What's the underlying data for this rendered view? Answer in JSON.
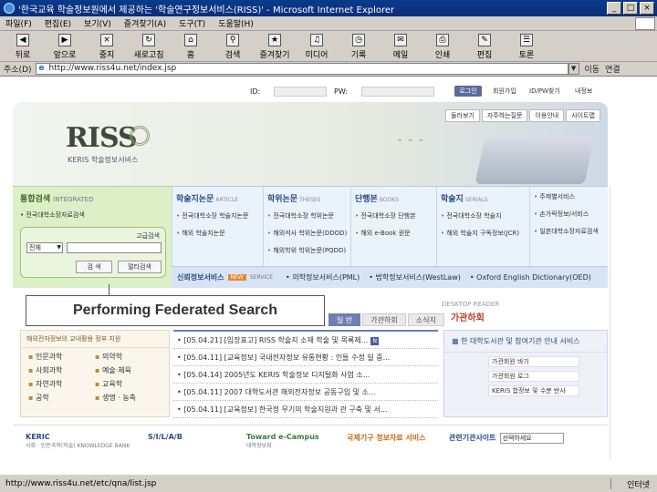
{
  "window": {
    "title": "'한국교육 학술정보원에서 제공하는 '학술연구정보서비스(RISS)' - Microsoft Internet Explorer",
    "buttons": [
      "_",
      "□",
      "×"
    ]
  },
  "menu": [
    "파일(F)",
    "편집(E)",
    "보기(V)",
    "즐겨찾기(A)",
    "도구(T)",
    "도움말(H)"
  ],
  "toolbar": [
    {
      "label": "뒤로",
      "icon": "back-arrow-icon",
      "glyph": "◀"
    },
    {
      "label": "앞으로",
      "icon": "forward-arrow-icon",
      "glyph": "▶"
    },
    {
      "label": "중지",
      "icon": "stop-icon",
      "glyph": "×"
    },
    {
      "label": "새로고침",
      "icon": "refresh-icon",
      "glyph": "↻"
    },
    {
      "label": "홈",
      "icon": "home-icon",
      "glyph": "⌂"
    },
    {
      "label": "검색",
      "icon": "search-icon",
      "glyph": "⚲"
    },
    {
      "label": "즐겨찾기",
      "icon": "favorites-icon",
      "glyph": "★"
    },
    {
      "label": "미디어",
      "icon": "media-icon",
      "glyph": "♫"
    },
    {
      "label": "기록",
      "icon": "history-icon",
      "glyph": "◷"
    },
    {
      "label": "메일",
      "icon": "mail-icon",
      "glyph": "✉"
    },
    {
      "label": "인쇄",
      "icon": "print-icon",
      "glyph": "⎙"
    },
    {
      "label": "편집",
      "icon": "edit-icon",
      "glyph": "✎"
    },
    {
      "label": "토론",
      "icon": "discuss-icon",
      "glyph": "☰"
    }
  ],
  "address": {
    "label": "주소(D)",
    "url": "http://www.riss4u.net/index.jsp",
    "go": "이동",
    "links": "연결"
  },
  "login": {
    "id_label": "ID:",
    "pw_label": "PW:",
    "button": "로그인",
    "links": [
      "회원가입",
      "ID/PW찾기",
      "내정보"
    ]
  },
  "hero": {
    "logo": "RISS",
    "logo_sub": "KERIS 학술정보서비스",
    "top_links": [
      "둘러보기",
      "자주하는질문",
      "이용안내",
      "사이트맵"
    ]
  },
  "search": {
    "heading": "통합검색",
    "heading_en": "INTEGRATED",
    "option": "전국대학소장자료검색",
    "advanced": "고급검색",
    "select_value": "전체",
    "query": "",
    "search_button": "검 색",
    "multi_button": "멀티검색"
  },
  "categories": [
    {
      "title": "학술지논문",
      "en": "ARTICLE",
      "items": [
        "전국대학소장 학술지논문",
        "해외 학술지논문"
      ]
    },
    {
      "title": "학위논문",
      "en": "THESES",
      "items": [
        "전국대학소장 학위논문",
        "해외석사 학위논문(DDOD)",
        "해외학위 학위논문(PQDD)"
      ]
    },
    {
      "title": "단행본",
      "en": "BOOKS",
      "items": [
        "전국대학소장 단행본",
        "해외 e-Book 원문"
      ]
    },
    {
      "title": "학술지",
      "en": "SERIALS",
      "items": [
        "전국대학소장 학술지",
        "해외 학술지 구독정보(JCR)"
      ]
    },
    {
      "title": "",
      "en": "",
      "items": [
        "주제별서비스",
        "손가락정보/서비스",
        "일본대학소장자료검색"
      ]
    }
  ],
  "services": {
    "lead": "신뢰정보서비스",
    "tag": "NEW",
    "more": "SERVICE",
    "links": [
      "의학정보서비스(PML)",
      "법학정보서비스(WestLaw)",
      "Oxford English Dictionary(OED)"
    ]
  },
  "callout": "Performing Federated Search",
  "ebook": {
    "tag": "DESKTOP READER",
    "title": "가관하회"
  },
  "tabs": [
    "일 반",
    "가관하회",
    "소식지"
  ],
  "left_panel": {
    "heading": "해외전자정보의 교내활용 정부 지원",
    "items": [
      "인문과학",
      "의약학",
      "사회과학",
      "예술·체육",
      "자연과학",
      "교육학",
      "공학",
      "생명 · 농축"
    ]
  },
  "notices": [
    "[05.04.21] [입장표고] RISS 학술지 소재 학술 및 목록제...",
    "[05.04.11] [교육정보] 국내전자정보 유통현황 : 인들 수정 일 중...",
    "[05.04.14] 2005년도 KERIS 학술정보 디지털화 사업 소...",
    "[05.04.11] 2007 대학도서관 해외전자정보 공동구입 및 소...",
    "[05.04.11] [교육정보] 한국정 무기의 학술지원과 관 구축 및 서..."
  ],
  "right_panel": {
    "heading": "한 대학도서관 및 참여기관 안내 서비스",
    "items": [
      "가관회원 바기",
      "가관회원 로그",
      "KERIS 합정보 및 수분 반사"
    ]
  },
  "banners": [
    {
      "title": "KERIC",
      "sub": "사회 · 인문과학(학술) KNOWLEDGE BANK",
      "style": "blue"
    },
    {
      "title": "S/I/L/A/B",
      "sub": "",
      "style": "blue"
    },
    {
      "title": "Toward e-Campus",
      "sub": "대학정보화",
      "style": "grn"
    },
    {
      "title": "국제기구 정보자료 서비스",
      "sub": "",
      "style": "orng"
    },
    {
      "title": "관련기관사이트",
      "sub": "",
      "style": "blue",
      "select": "선택하세요"
    }
  ],
  "status": {
    "text": "http://www.riss4u.net/etc/qna/list.jsp",
    "zone": "인터넷"
  }
}
